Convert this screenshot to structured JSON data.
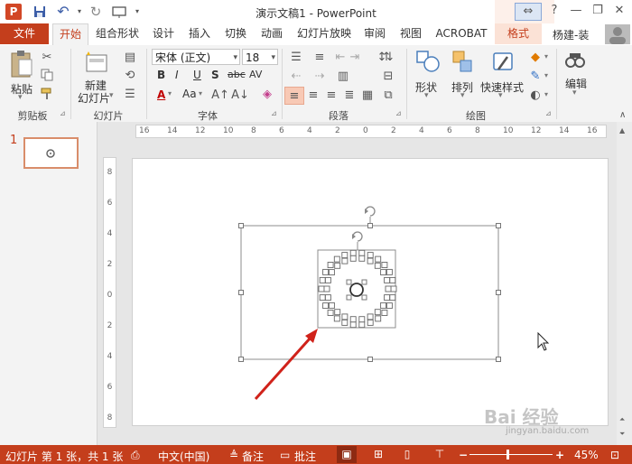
{
  "window": {
    "title": "演示文稿1 - PowerPoint",
    "app_icon_letter": "P",
    "minimize": "—",
    "restore": "❐",
    "close": "✕",
    "help": "?"
  },
  "quick_access": [
    {
      "name": "save-icon",
      "glyph": "💾"
    },
    {
      "name": "undo-icon",
      "glyph": "↶"
    },
    {
      "name": "redo-icon",
      "glyph": "↻"
    },
    {
      "name": "present-icon",
      "glyph": "⊡"
    }
  ],
  "tabs": [
    "文件",
    "开始",
    "组合形状",
    "设计",
    "插入",
    "切换",
    "动画",
    "幻灯片放映",
    "审阅",
    "视图",
    "ACROBAT",
    "格式"
  ],
  "user": {
    "name": "杨建-装"
  },
  "ribbon": {
    "clipboard": {
      "label": "剪贴板",
      "paste": "粘贴"
    },
    "slides": {
      "label": "幻灯片",
      "new_slide_line1": "新建",
      "new_slide_line2": "幻灯片"
    },
    "font": {
      "label": "字体",
      "font_name": "宋体 (正文)",
      "font_size": "18",
      "bold": "B",
      "italic": "I",
      "underline": "U",
      "shadow": "S",
      "strike": "abc",
      "spacing": "AV",
      "font_color": "A",
      "change_case": "Aa"
    },
    "paragraph": {
      "label": "段落"
    },
    "drawing": {
      "label": "绘图",
      "shapes": "形状",
      "arrange": "排列",
      "quick_styles": "快速样式"
    },
    "editing": {
      "label": "编辑",
      "edit": "编辑"
    }
  },
  "rulers": {
    "horizontal": [
      "16",
      "14",
      "12",
      "10",
      "8",
      "6",
      "4",
      "2",
      "0",
      "2",
      "4",
      "6",
      "8",
      "10",
      "12",
      "14",
      "16"
    ],
    "vertical": [
      "8",
      "6",
      "4",
      "2",
      "0",
      "2",
      "4",
      "6",
      "8"
    ]
  },
  "thumbnails": [
    {
      "number": "1"
    }
  ],
  "statusbar": {
    "slide_info": "幻灯片 第 1 张，共 1 张",
    "language": "中文(中国)",
    "notes": "备注",
    "comments": "批注",
    "zoom": "45%",
    "zoom_level": 0.45
  },
  "watermark": {
    "text": "Bai 经验",
    "url": "jingyan.baidu.com"
  },
  "colors": {
    "accent": "#c43e1c",
    "arrow": "#d0221a",
    "ribbon_bg": "#f3f3f3"
  }
}
